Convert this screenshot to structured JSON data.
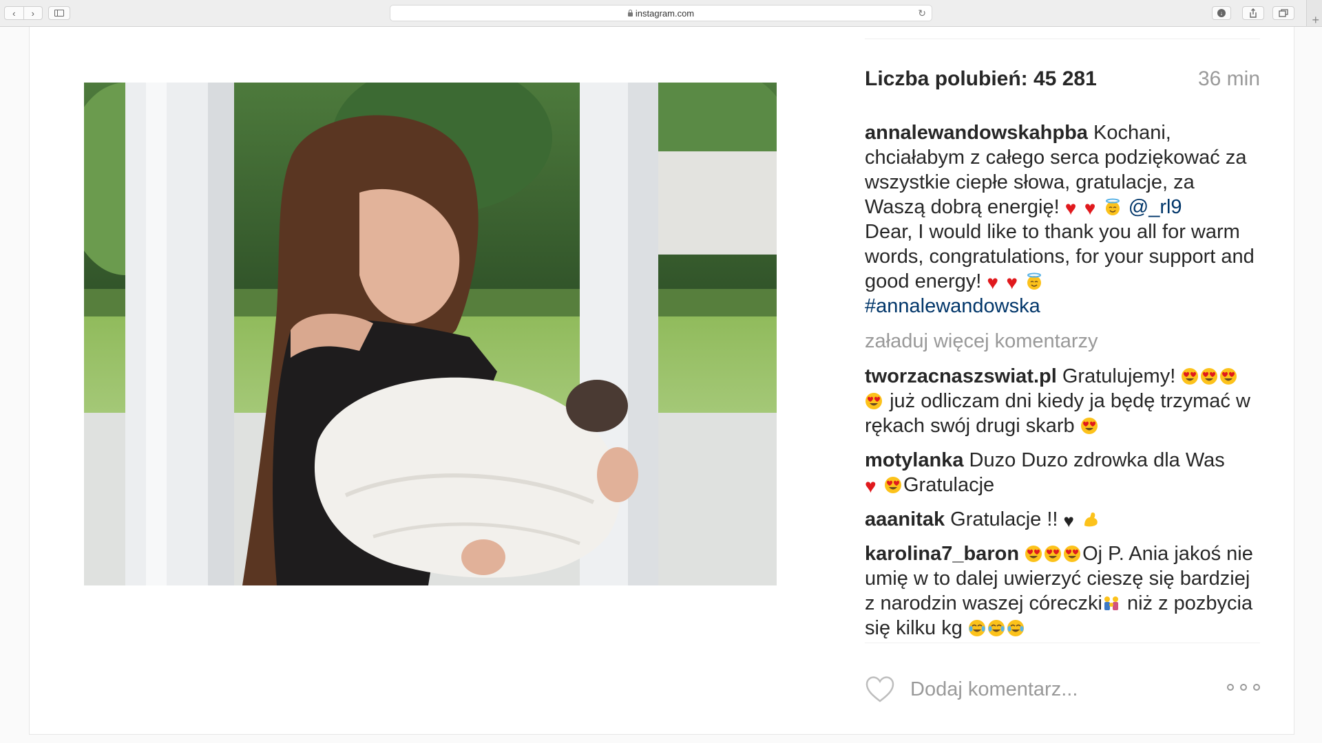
{
  "browser": {
    "url": "instagram.com"
  },
  "post": {
    "likes_label": "Liczba polubień: 45 281",
    "time_ago": "36 min",
    "caption": {
      "username": "annalewandowskahpba",
      "text_pl": "Kochani, chciałabym z całego serca podziękować za wszystkie ciepłe słowa, gratulacje, za Waszą dobrą energię!",
      "mention": "@_rl9",
      "text_en": "Dear, I would like to thank you all for warm words, congratulations, for your support and good energy!",
      "hashtag": "#annalewandowska"
    },
    "load_more": "załaduj więcej komentarzy",
    "comments": [
      {
        "username": "tworzacnaszswiat.pl",
        "text_a": "Gratulujemy!",
        "text_b": "już odliczam dni kiedy ja będę trzymać w rękach swój drugi skarb"
      },
      {
        "username": "motylanka",
        "text_a": "Duzo Duzo zdrowka dla Was",
        "text_b": "Gratulacje"
      },
      {
        "username": "aaanitak",
        "text_a": "Gratulacje !!"
      },
      {
        "username": "karolina7_baron",
        "text_a": "Oj P. Ania jakoś nie umię w to dalej uwierzyć cieszę się bardziej z narodzin waszej córeczki",
        "text_b": "niż z pozbycia się kilku kg"
      }
    ],
    "add_comment_placeholder": "Dodaj komentarz..."
  },
  "colors": {
    "link": "#003569",
    "muted": "#999999",
    "text": "#262626",
    "heart": "#e0191d"
  },
  "icons": {
    "back": "chevron-left-icon",
    "forward": "chevron-right-icon",
    "like": "heart-outline-icon",
    "more": "ellipsis-icon",
    "emoji": [
      "red-heart-emoji",
      "smiling-halo-emoji",
      "heart-eyes-emoji",
      "black-heart-emoji",
      "flexed-biceps-emoji",
      "family-emoji",
      "tears-of-joy-emoji"
    ]
  }
}
